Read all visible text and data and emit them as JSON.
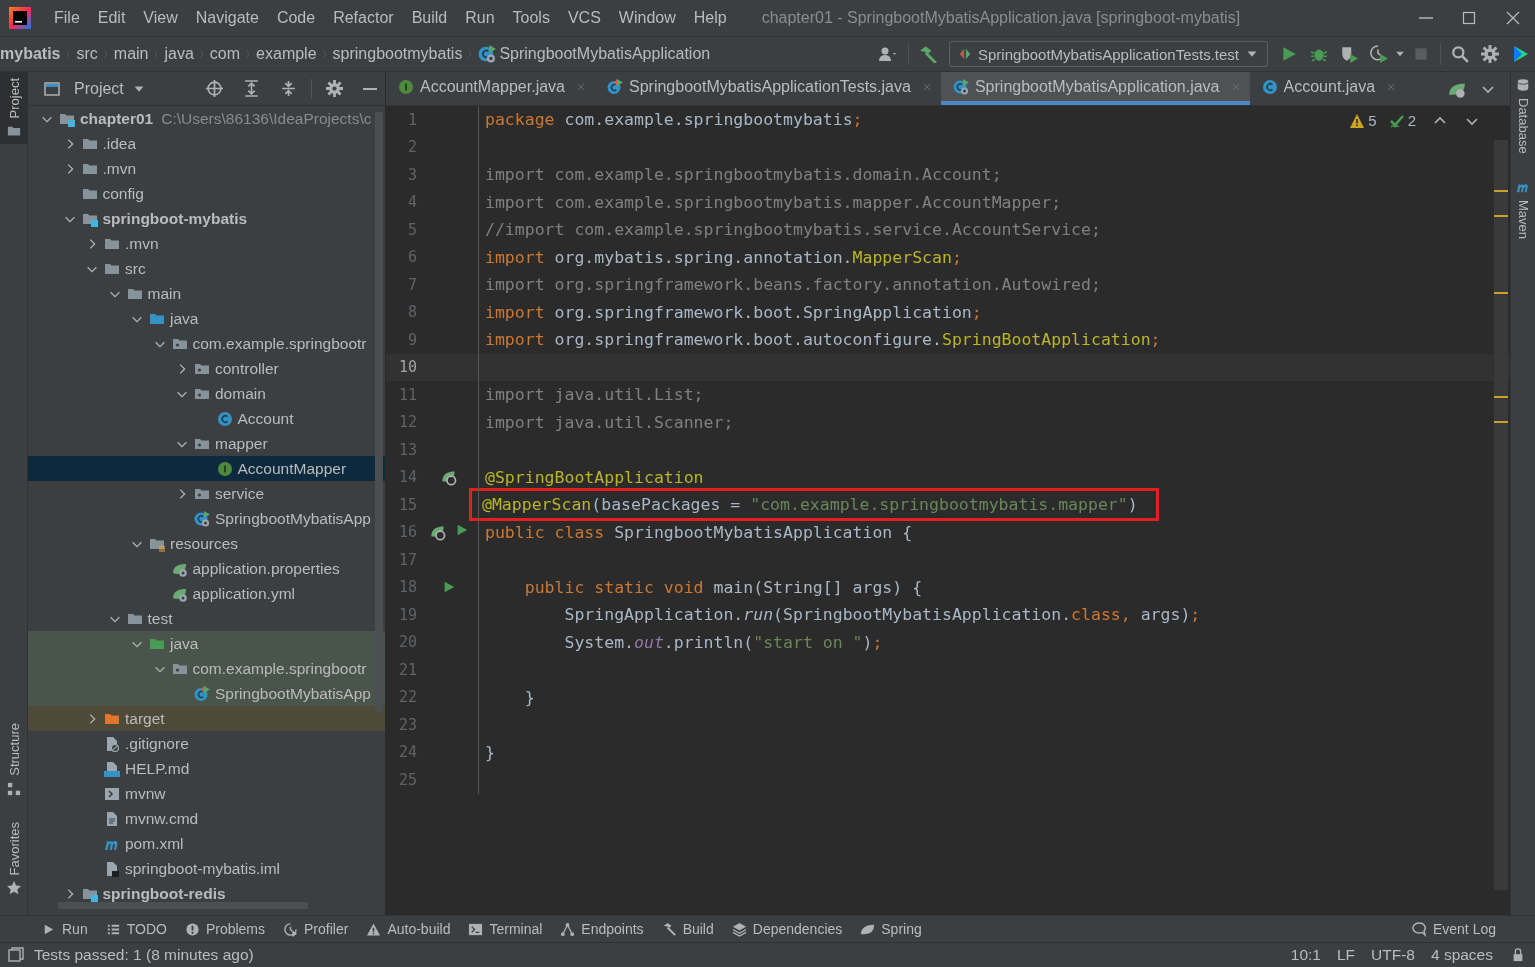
{
  "menu_bar": {
    "menus": [
      "File",
      "Edit",
      "View",
      "Navigate",
      "Code",
      "Refactor",
      "Build",
      "Run",
      "Tools",
      "VCS",
      "Window",
      "Help"
    ],
    "title": "chapter01 - SpringbootMybatisApplication.java [springboot-mybatis]"
  },
  "nav_bar": {
    "breadcrumbs": [
      {
        "label": "mybatis",
        "kind": "path"
      },
      {
        "label": "src",
        "kind": "path"
      },
      {
        "label": "main",
        "kind": "path"
      },
      {
        "label": "java",
        "kind": "path"
      },
      {
        "label": "com",
        "kind": "path"
      },
      {
        "label": "example",
        "kind": "path"
      },
      {
        "label": "springbootmybatis",
        "kind": "path"
      },
      {
        "label": "SpringbootMybatisApplication",
        "kind": "spring-class"
      }
    ],
    "run_config": "SpringbootMybatisApplicationTests.test"
  },
  "left_stripe": {
    "top": [
      {
        "label": "Project",
        "selected": true
      }
    ],
    "bottom": [
      {
        "label": "Structure",
        "selected": false
      },
      {
        "label": "Favorites",
        "selected": false
      }
    ]
  },
  "project_panel": {
    "title": "Project",
    "tree": [
      {
        "name": "chapter01",
        "kind": "module",
        "bold": true,
        "note": "C:\\Users\\86136\\IdeaProjects\\c",
        "expanded": true,
        "selected": false,
        "children": [
          {
            "name": ".idea",
            "kind": "folder",
            "expanded": false,
            "selected": false
          },
          {
            "name": ".mvn",
            "kind": "folder",
            "expanded": false,
            "selected": false
          },
          {
            "name": "config",
            "kind": "folder",
            "selected": false
          },
          {
            "name": "springboot-mybatis",
            "kind": "module",
            "bold": true,
            "expanded": true,
            "selected": false,
            "children": [
              {
                "name": ".mvn",
                "kind": "folder",
                "expanded": false,
                "selected": false
              },
              {
                "name": "src",
                "kind": "folder",
                "expanded": true,
                "selected": false,
                "children": [
                  {
                    "name": "main",
                    "kind": "folder",
                    "expanded": true,
                    "selected": false,
                    "children": [
                      {
                        "name": "java",
                        "kind": "source-folder",
                        "expanded": true,
                        "selected": false,
                        "children": [
                          {
                            "name": "com.example.springbootr",
                            "kind": "package",
                            "expanded": true,
                            "selected": false,
                            "children": [
                              {
                                "name": "controller",
                                "kind": "package",
                                "expanded": false,
                                "selected": false
                              },
                              {
                                "name": "domain",
                                "kind": "package",
                                "expanded": true,
                                "selected": false,
                                "children": [
                                  {
                                    "name": "Account",
                                    "kind": "class",
                                    "selected": false
                                  }
                                ]
                              },
                              {
                                "name": "mapper",
                                "kind": "package",
                                "expanded": true,
                                "selected": false,
                                "children": [
                                  {
                                    "name": "AccountMapper",
                                    "kind": "interface",
                                    "selected": true
                                  }
                                ]
                              },
                              {
                                "name": "service",
                                "kind": "package",
                                "expanded": false,
                                "selected": false
                              },
                              {
                                "name": "SpringbootMybatisApp",
                                "kind": "spring-class",
                                "selected": false
                              }
                            ]
                          }
                        ]
                      },
                      {
                        "name": "resources",
                        "kind": "resources-folder",
                        "expanded": true,
                        "selected": false,
                        "children": [
                          {
                            "name": "application.properties",
                            "kind": "spring-config",
                            "selected": false
                          },
                          {
                            "name": "application.yml",
                            "kind": "spring-config",
                            "selected": false
                          }
                        ]
                      }
                    ]
                  },
                  {
                    "name": "test",
                    "kind": "folder",
                    "expanded": true,
                    "selected": false,
                    "children": [
                      {
                        "name": "java",
                        "kind": "test-folder",
                        "expanded": true,
                        "selected": false,
                        "children": [
                          {
                            "name": "com.example.springbootr",
                            "kind": "test-package",
                            "expanded": true,
                            "selected": false,
                            "children": [
                              {
                                "name": "SpringbootMybatisApp",
                                "kind": "test-class",
                                "selected": false
                              }
                            ]
                          }
                        ]
                      }
                    ]
                  }
                ]
              },
              {
                "name": "target",
                "kind": "excluded-folder",
                "expanded": false,
                "selected": false
              },
              {
                "name": ".gitignore",
                "kind": "ignore-file",
                "selected": false
              },
              {
                "name": "HELP.md",
                "kind": "markdown",
                "selected": false
              },
              {
                "name": "mvnw",
                "kind": "script",
                "selected": false
              },
              {
                "name": "mvnw.cmd",
                "kind": "text",
                "selected": false
              },
              {
                "name": "pom.xml",
                "kind": "maven",
                "selected": false
              },
              {
                "name": "springboot-mybatis.iml",
                "kind": "iml",
                "selected": false
              }
            ]
          },
          {
            "name": "springboot-redis",
            "kind": "module",
            "bold": true,
            "expanded": false,
            "selected": false
          }
        ]
      }
    ]
  },
  "editor": {
    "tabs": [
      {
        "label": "AccountMapper.java",
        "kind": "interface",
        "selected": false
      },
      {
        "label": "SpringbootMybatisApplicationTests.java",
        "kind": "test-class",
        "selected": false
      },
      {
        "label": "SpringbootMybatisApplication.java",
        "kind": "spring-class",
        "selected": true
      },
      {
        "label": "Account.java",
        "kind": "class",
        "selected": false
      }
    ],
    "warnings": "5",
    "weak_warnings": "2",
    "lines": [
      {
        "number": "1",
        "current": false,
        "boxed": false,
        "segments": [
          {
            "kind": "kw",
            "text": "package"
          },
          {
            "kind": "plain",
            "text": " com.example.springbootmybatis"
          },
          {
            "kind": "kw",
            "text": ";"
          }
        ]
      },
      {
        "number": "2",
        "current": false
      },
      {
        "number": "3",
        "current": false,
        "boxed": false,
        "segments": [
          {
            "kind": "unused",
            "text": "import com.example.springbootmybatis.domain.Account;"
          }
        ]
      },
      {
        "number": "4",
        "current": false,
        "boxed": false,
        "segments": [
          {
            "kind": "unused",
            "text": "import com.example.springbootmybatis.mapper.AccountMapper;"
          }
        ]
      },
      {
        "number": "5",
        "current": false,
        "boxed": false,
        "segments": [
          {
            "kind": "unused",
            "text": "//import com.example.springbootmybatis.service.AccountService;"
          }
        ]
      },
      {
        "number": "6",
        "current": false,
        "boxed": false,
        "segments": [
          {
            "kind": "kw",
            "text": "import"
          },
          {
            "kind": "plain",
            "text": " org.mybatis.spring.annotation."
          },
          {
            "kind": "ann",
            "text": "MapperScan"
          },
          {
            "kind": "kw",
            "text": ";"
          }
        ]
      },
      {
        "number": "7",
        "current": false,
        "boxed": false,
        "segments": [
          {
            "kind": "unused",
            "text": "import org.springframework.beans.factory.annotation.Autowired;"
          }
        ]
      },
      {
        "number": "8",
        "current": false,
        "boxed": false,
        "segments": [
          {
            "kind": "kw",
            "text": "import"
          },
          {
            "kind": "plain",
            "text": " org.springframework.boot.SpringApplication"
          },
          {
            "kind": "kw",
            "text": ";"
          }
        ]
      },
      {
        "number": "9",
        "current": false,
        "boxed": false,
        "segments": [
          {
            "kind": "kw",
            "text": "import"
          },
          {
            "kind": "plain",
            "text": " org.springframework.boot.autoconfigure."
          },
          {
            "kind": "ann",
            "text": "SpringBootApplication"
          },
          {
            "kind": "kw",
            "text": ";"
          }
        ]
      },
      {
        "number": "10",
        "current": true
      },
      {
        "number": "11",
        "current": false,
        "boxed": false,
        "segments": [
          {
            "kind": "unused",
            "text": "import java.util.List;"
          }
        ]
      },
      {
        "number": "12",
        "current": false,
        "boxed": false,
        "segments": [
          {
            "kind": "unused",
            "text": "import java.util.Scanner;"
          }
        ]
      },
      {
        "number": "13",
        "current": false
      },
      {
        "number": "14",
        "current": false,
        "boxed": false,
        "gutter_icons": [
          {
            "kind": "bean"
          }
        ],
        "segments": [
          {
            "kind": "ann",
            "text": "@SpringBootApplication"
          }
        ]
      },
      {
        "number": "15",
        "current": false,
        "boxed": true,
        "segments": [
          {
            "kind": "ann",
            "text": "@MapperScan"
          },
          {
            "kind": "plain",
            "text": "(basePackages = "
          },
          {
            "kind": "str",
            "text": "\"com.example.springbootmybatis.mapper\""
          },
          {
            "kind": "plain",
            "text": ")"
          }
        ]
      },
      {
        "number": "16",
        "current": false,
        "boxed": false,
        "gutter_icons": [
          {
            "kind": "bean"
          },
          {
            "kind": "run"
          }
        ],
        "segments": [
          {
            "kind": "kw",
            "text": "public class "
          },
          {
            "kind": "plain",
            "text": "SpringbootMybatisApplication {"
          }
        ]
      },
      {
        "number": "17",
        "current": false
      },
      {
        "number": "18",
        "current": false,
        "boxed": false,
        "gutter_icons": [
          {
            "kind": "run"
          }
        ],
        "segments": [
          {
            "kind": "kw",
            "text": "    public static void "
          },
          {
            "kind": "plain",
            "text": "main(String[] args) {"
          }
        ]
      },
      {
        "number": "19",
        "current": false,
        "boxed": false,
        "segments": [
          {
            "kind": "plain",
            "text": "        SpringApplication."
          },
          {
            "kind": "italic",
            "text": "run"
          },
          {
            "kind": "plain",
            "text": "(SpringbootMybatisApplication."
          },
          {
            "kind": "kw",
            "text": "class, "
          },
          {
            "kind": "plain",
            "text": "args)"
          },
          {
            "kind": "kw",
            "text": ";"
          }
        ]
      },
      {
        "number": "20",
        "current": false,
        "boxed": false,
        "segments": [
          {
            "kind": "plain",
            "text": "        System."
          },
          {
            "kind": "field",
            "text": "out"
          },
          {
            "kind": "plain",
            "text": ".println("
          },
          {
            "kind": "str",
            "text": "\"start on \""
          },
          {
            "kind": "plain",
            "text": ")"
          },
          {
            "kind": "kw",
            "text": ";"
          }
        ]
      },
      {
        "number": "21",
        "current": false
      },
      {
        "number": "22",
        "current": false,
        "boxed": false,
        "segments": [
          {
            "kind": "plain",
            "text": "    }"
          }
        ]
      },
      {
        "number": "23",
        "current": false
      },
      {
        "number": "24",
        "current": false,
        "boxed": false,
        "segments": [
          {
            "kind": "plain",
            "text": "}"
          }
        ]
      },
      {
        "number": "25",
        "current": false
      }
    ]
  },
  "right_stripe": [
    {
      "label": "Database",
      "kind": "database",
      "selected": false
    },
    {
      "label": "Maven",
      "kind": "maven",
      "selected": false
    }
  ],
  "tool_bar": [
    {
      "label": "Run",
      "kind": "run"
    },
    {
      "label": "TODO",
      "kind": "list"
    },
    {
      "label": "Problems",
      "kind": "problem"
    },
    {
      "label": "Profiler",
      "kind": "profiler"
    },
    {
      "label": "Auto-build",
      "kind": "warning"
    },
    {
      "label": "Terminal",
      "kind": "terminal"
    },
    {
      "label": "Endpoints",
      "kind": "endpoints"
    },
    {
      "label": "Build",
      "kind": "hammer"
    },
    {
      "label": "Dependencies",
      "kind": "layers"
    },
    {
      "label": "Spring",
      "kind": "leaf"
    }
  ],
  "event_log": "Event Log",
  "status_bar": {
    "message": "Tests passed: 1 (8 minutes ago)",
    "position": "10:1",
    "line_separator": "LF",
    "encoding": "UTF-8",
    "indent": "4 spaces"
  }
}
